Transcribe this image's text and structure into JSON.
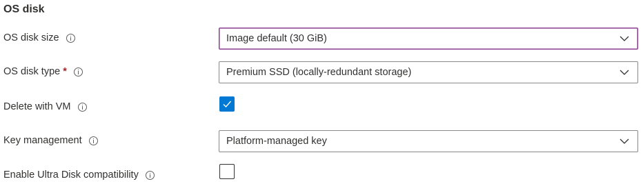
{
  "section": {
    "title": "OS disk"
  },
  "fields": {
    "os_disk_size": {
      "label": "OS disk size",
      "value": "Image default (30 GiB)",
      "icon": "info-icon"
    },
    "os_disk_type": {
      "label": "OS disk type",
      "required_mark": "*",
      "value": "Premium SSD (locally-redundant storage)",
      "icon": "info-icon"
    },
    "delete_with_vm": {
      "label": "Delete with VM",
      "checked": true,
      "icon": "info-icon"
    },
    "key_management": {
      "label": "Key management",
      "value": "Platform-managed key",
      "icon": "info-icon"
    },
    "ultra_disk": {
      "label": "Enable Ultra Disk compatibility",
      "checked": false,
      "icon": "info-icon"
    }
  },
  "colors": {
    "accent": "#0078d4",
    "focus_border": "#8a3b8f",
    "required": "#a4262c",
    "text": "#323130"
  }
}
